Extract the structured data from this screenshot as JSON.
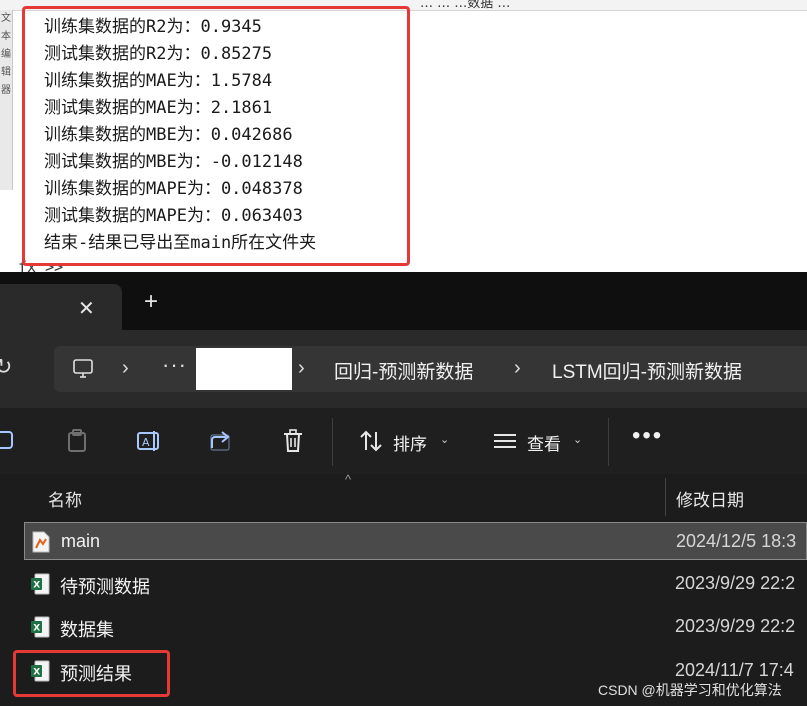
{
  "console": {
    "header_partial": "…  …  …数据 …",
    "gutter_chars": [
      "文",
      "本",
      "编",
      "辑",
      "器"
    ],
    "lines": [
      "训练集数据的R2为：0.9345",
      "测试集数据的R2为：0.85275",
      "训练集数据的MAE为：1.5784",
      "测试集数据的MAE为：2.1861",
      "训练集数据的MBE为：0.042686",
      "测试集数据的MBE为：-0.012148",
      "训练集数据的MAPE为：0.048378",
      "测试集数据的MAPE为：0.063403",
      "结束-结果已导出至main所在文件夹"
    ],
    "prompt": "fx >>"
  },
  "explorer": {
    "tab": {
      "close_glyph": "✕",
      "new_tab_glyph": "+"
    },
    "address": {
      "refresh_glyph": "↻",
      "pc_icon": "monitor-icon",
      "chevron": "›",
      "ellipsis": "···",
      "crumbs": [
        "回归-预测新数据",
        "LSTM回归-预测新数据"
      ]
    },
    "toolbar": {
      "sort_label": "排序",
      "view_label": "查看",
      "more_label": "•••",
      "caret": "⌄"
    },
    "columns": {
      "name": "名称",
      "date": "修改日期"
    },
    "files": [
      {
        "name": "main",
        "date": "2024/12/5 18:3",
        "icon": "matlab-file-icon",
        "selected": true
      },
      {
        "name": "待预测数据",
        "date": "2023/9/29 22:2",
        "icon": "excel-file-icon",
        "selected": false
      },
      {
        "name": "数据集",
        "date": "2023/9/29 22:2",
        "icon": "excel-file-icon",
        "selected": false
      },
      {
        "name": "预测结果",
        "date": "2024/11/7 17:4",
        "icon": "excel-file-icon",
        "selected": false
      }
    ],
    "colors": {
      "background": "#1c1c1c",
      "accent": "#a9c7ff",
      "excel_green": "#1e7145",
      "highlight": "#e53935"
    }
  },
  "watermark": "CSDN @机器学习和优化算法"
}
